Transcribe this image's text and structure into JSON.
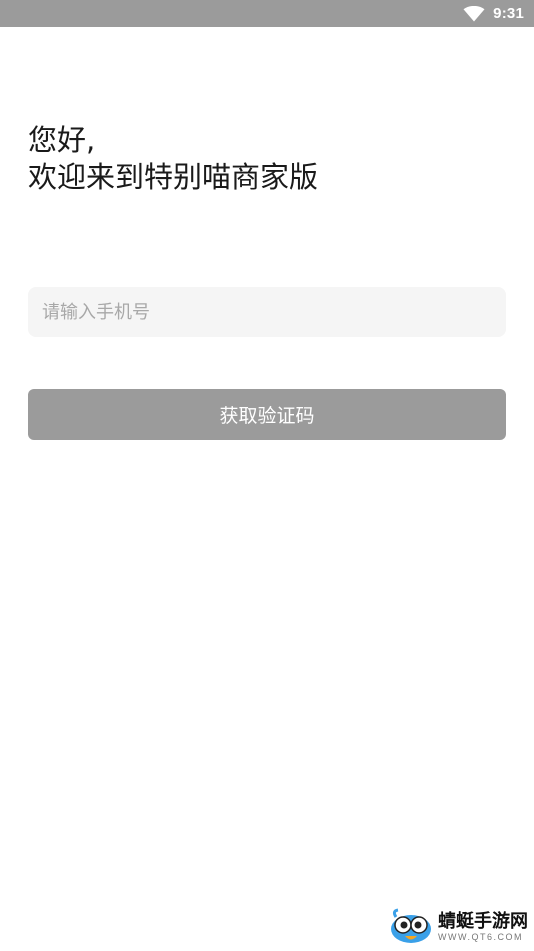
{
  "status_bar": {
    "time": "9:31",
    "icons": [
      "wifi-icon"
    ]
  },
  "greeting": {
    "line1": "您好,",
    "line2": "欢迎来到特别喵商家版"
  },
  "phone_input": {
    "placeholder": "请输入手机号",
    "value": ""
  },
  "get_code_button": {
    "label": "获取验证码"
  },
  "watermark": {
    "name": "蜻蜓手游网",
    "url": "WWW.QT6.COM"
  },
  "colors": {
    "status_bar_bg": "#9b9b9b",
    "button_bg": "#9b9b9b",
    "input_bg": "#f5f5f5",
    "text_primary": "#1a1a1a",
    "placeholder": "#a8a8a8"
  }
}
